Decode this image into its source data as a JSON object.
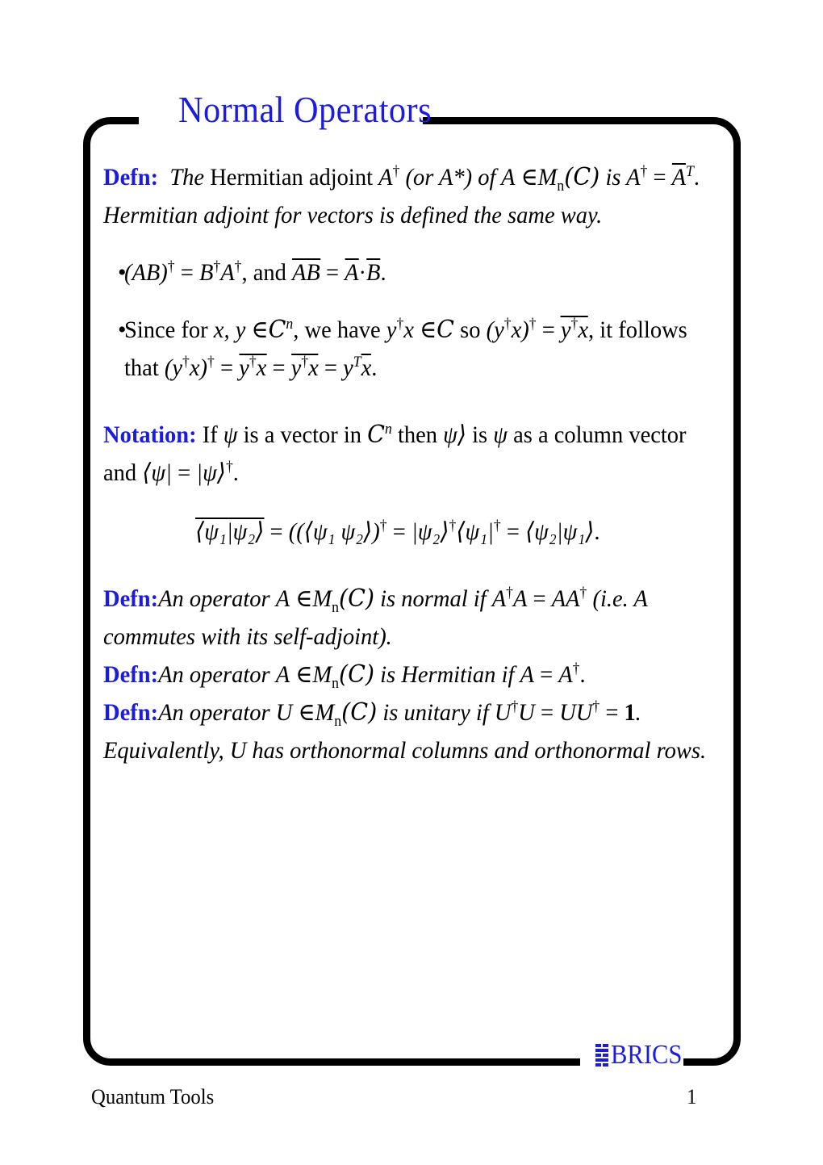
{
  "document": {
    "type": "lecture-slide",
    "title": "Normal Operators",
    "title_color": "#1c1ce0",
    "frame_color": "#000000"
  },
  "logo": {
    "name": "BRICS",
    "color": "#1c1ce0"
  },
  "footer": {
    "left": "Quantum Tools",
    "page_number": "1"
  },
  "body": {
    "defn_adjoint": {
      "keyword": "Defn:",
      "text_1": "The",
      "text_2": "Hermitian adjoint",
      "A1": "A",
      "dag1": "†",
      "paren": "(or A*) of",
      "A2": "A",
      "member": "∈",
      "M": "M",
      "n": "n",
      "Cset": "(C)",
      "is": "is",
      "A3": "A",
      "dag2": "†",
      "eq": "=",
      "Abar": "A",
      "T": "T",
      "period": ".",
      "line2": "Hermitian adjoint for vectors is defined the same way."
    },
    "bullet_1": {
      "marker": "•",
      "part_1": "(AB)",
      "dag_1": "†",
      "eq_1": "=",
      "B": "B",
      "dag_2": "†",
      "A": "A",
      "dag_3": "†",
      "and": ", and",
      "AB_bar": "AB",
      "eq_2": "=",
      "A_bar": "A",
      "dot": "·",
      "B_bar": "B",
      "period": "."
    },
    "bullet_2": {
      "marker": "•",
      "l1_t1": "Since for",
      "l1_xy": "x, y",
      "l1_in": "∈",
      "l1_C": "C",
      "l1_n": "n",
      "l1_t2": ", we have",
      "l1_yx": "y",
      "l1_dag": "†",
      "l1_x": "x",
      "l1_in2": "∈",
      "l1_C2": "C",
      "l1_so": "so",
      "l1_p": "(y",
      "l1_dag2": "†",
      "l1_x2": "x)",
      "l1_dag3": "†",
      "l1_eq": "=",
      "l1_bar_y": "y",
      "l1_bar_dag": "†",
      "l1_bar_x": "x",
      "l1_tail": ", it follows",
      "l2_that": "that",
      "l2_p": "(y",
      "l2_dag": "†",
      "l2_x": "x)",
      "l2_dag2": "†",
      "l2_eq1": "=",
      "l2_b1y": "y",
      "l2_b1dag": "†",
      "l2_b1x": "x",
      "l2_eq2": "=",
      "l2_b2y": "y",
      "l2_b2dag": "†",
      "l2_b2x": "x",
      "l2_eq3": "=",
      "l2_y": "y",
      "l2_T": "T",
      "l2_xbar": "x",
      "l2_period": "."
    },
    "notation": {
      "keyword": "Notation:",
      "t1": "If",
      "psi1": "ψ",
      "t2": "is a vector in",
      "C": "C",
      "n": "n",
      "t3": "then",
      "ket": "ψ⟩",
      "t4": "is",
      "psi2": "ψ",
      "t5": "as a column vector",
      "l2_and": "and",
      "l2_bra": "⟨ψ|",
      "l2_eq": "=",
      "l2_ket": "|ψ⟩",
      "l2_dag": "†",
      "l2_period": "."
    },
    "equation": {
      "lhs_bar": "⟨ψ₁|ψ₂⟩",
      "eq1": "=",
      "mid": "((⟨ψ₁  ψ₂⟩)",
      "dag1": "†",
      "eq2": "=",
      "ket2": "|ψ₂⟩",
      "dag2": "†",
      "bra1": "⟨ψ₁|",
      "dag3": "†",
      "eq3": "=",
      "rhs": "⟨ψ₂|ψ₁⟩",
      "period": "."
    },
    "defn_normal": {
      "keyword": "Defn:",
      "t1": "An operator",
      "A": "A",
      "in": "∈",
      "M": "M",
      "n": "n",
      "C": "(C)",
      "t2": "is normal",
      "t3": "if",
      "A1": "A",
      "dag1": "†",
      "A2": "A",
      "eq": "=",
      "AA": "AA",
      "dag2": "†",
      "t4": "(i.e. A",
      "line2": "commutes with its self-adjoint)."
    },
    "defn_hermitian": {
      "keyword": "Defn:",
      "t1": "An operator",
      "A": "A",
      "in": "∈",
      "M": "M",
      "n": "n",
      "C": "(C)",
      "t2": "is Hermitian",
      "t3": "if",
      "A1": "A",
      "eq": "=",
      "A2": "A",
      "dag": "†",
      "period": "."
    },
    "defn_unitary": {
      "keyword": "Defn:",
      "t1": "An operator",
      "U": "U",
      "in": "∈",
      "M": "M",
      "n": "n",
      "C": "(C)",
      "t2": "is unitary",
      "t3": "if",
      "U1": "U",
      "dag1": "†",
      "U2": "U",
      "eq1": "=",
      "UU": "UU",
      "dag2": "†",
      "eq2": "=",
      "identity": "1",
      "period": "."
    },
    "closing": "Equivalently, U has orthonormal columns and orthonormal rows."
  }
}
